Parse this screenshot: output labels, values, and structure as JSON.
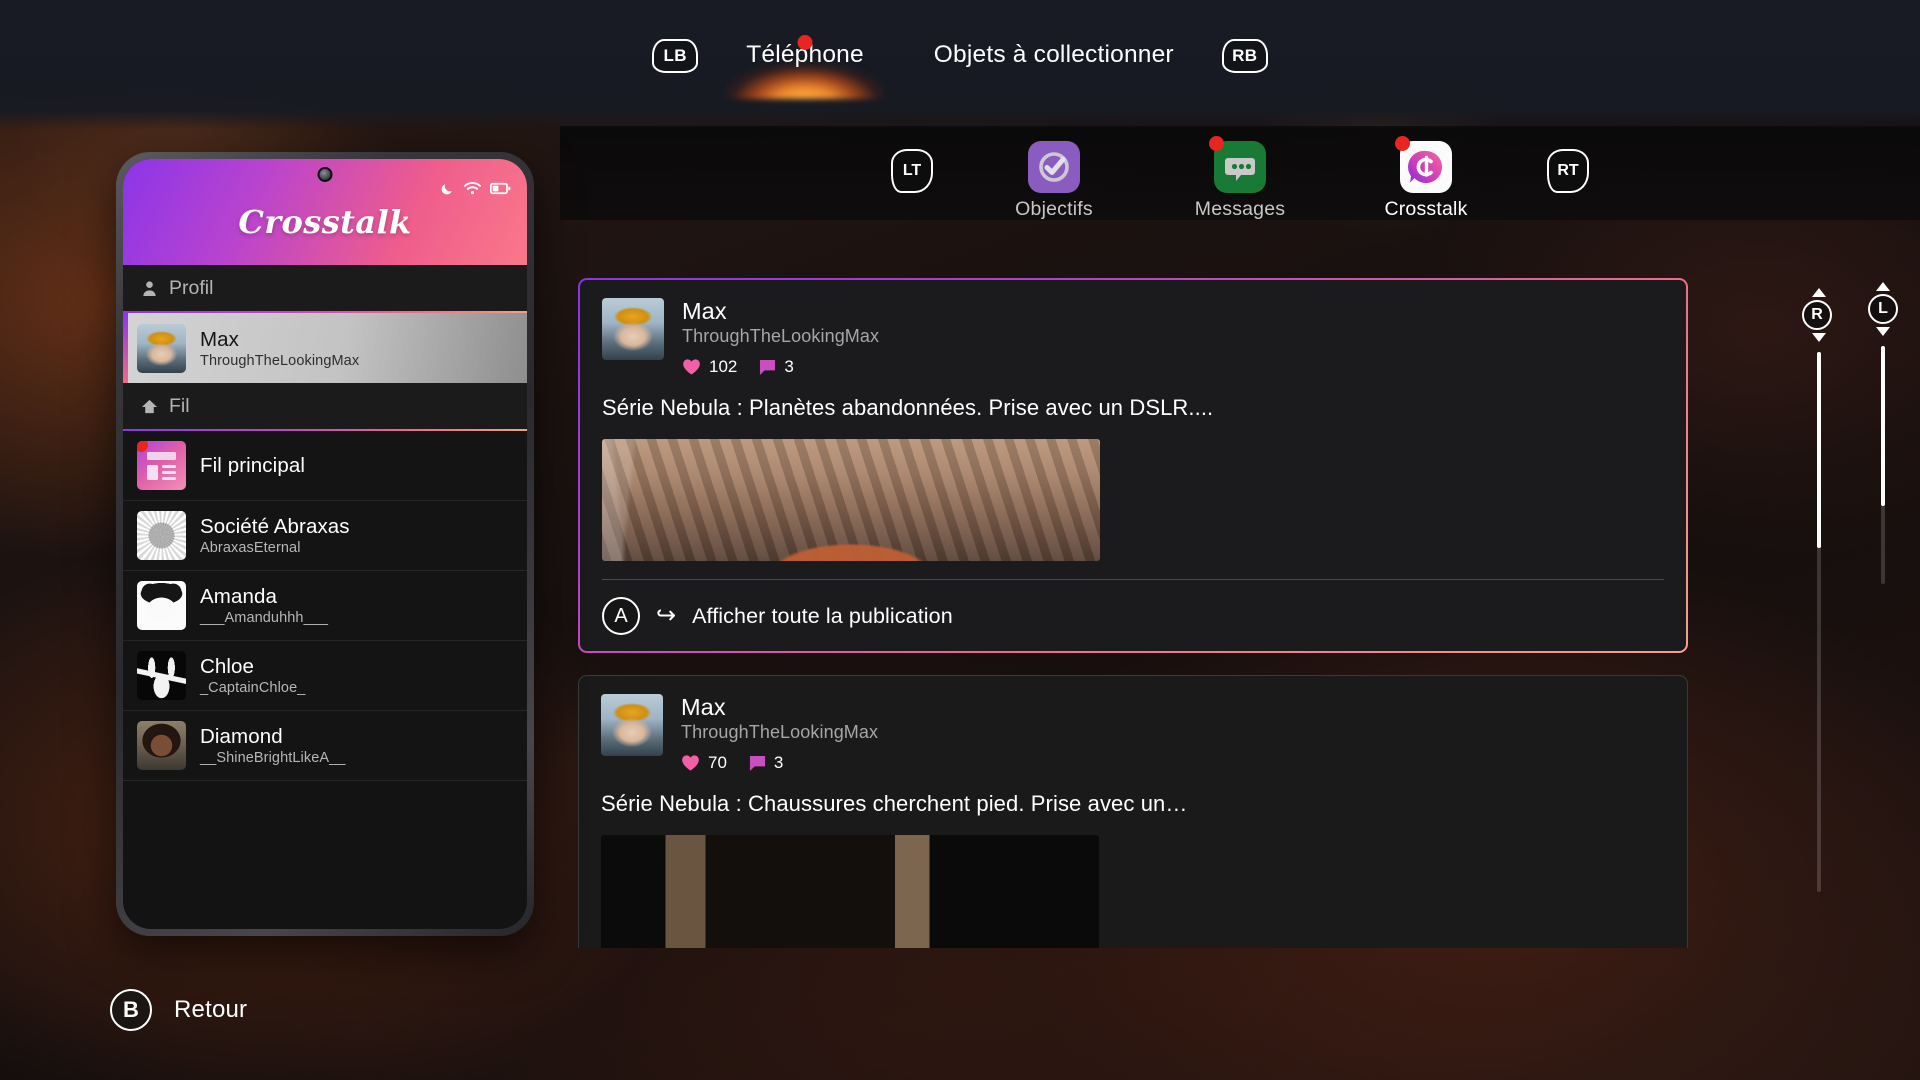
{
  "header": {
    "left_bumper": "LB",
    "right_bumper": "RB",
    "tabs": [
      {
        "label": "Téléphone",
        "active": true,
        "notification": true
      },
      {
        "label": "Objets à collectionner",
        "active": false,
        "notification": false
      }
    ]
  },
  "app_row": {
    "left_trigger": "LT",
    "right_trigger": "RT",
    "apps": [
      {
        "label": "Objectifs",
        "icon": "checkmark-circle-icon",
        "selected": false,
        "notification": false,
        "color": "#8a5cc0"
      },
      {
        "label": "Messages",
        "icon": "speech-bubble-icon",
        "selected": false,
        "notification": true,
        "color": "#197a36"
      },
      {
        "label": "Crosstalk",
        "icon": "crosstalk-c-icon",
        "selected": true,
        "notification": true,
        "color": "#ffffff"
      }
    ]
  },
  "phone": {
    "app_title": "Crosstalk",
    "status_icons": [
      "moon-icon",
      "wifi-icon",
      "battery-icon"
    ],
    "sections": [
      {
        "title": "Profil",
        "icon": "person-icon"
      },
      {
        "title": "Fil",
        "icon": "home-icon"
      }
    ],
    "profile": {
      "name": "Max",
      "handle": "ThroughTheLookingMax",
      "avatar": "max-avatar",
      "selected": true
    },
    "feed_items": [
      {
        "name": "Fil principal",
        "handle": "",
        "avatar": "news-feed-icon",
        "notification": true
      },
      {
        "name": "Société Abraxas",
        "handle": "AbraxasEternal",
        "avatar": "abraxas-avatar",
        "notification": false
      },
      {
        "name": "Amanda",
        "handle": "___Amanduhhh___",
        "avatar": "amanda-avatar",
        "notification": false
      },
      {
        "name": "Chloe",
        "handle": "_CaptainChloe_",
        "avatar": "chloe-avatar",
        "notification": false
      },
      {
        "name": "Diamond",
        "handle": "__ShineBrightLikeA__",
        "avatar": "diamond-avatar",
        "notification": false
      }
    ],
    "scroll_stick": "L"
  },
  "feed": {
    "scroll_stick": "R",
    "posts": [
      {
        "name": "Max",
        "handle": "ThroughTheLookingMax",
        "likes": "102",
        "comments": "3",
        "text": "Série Nebula : Planètes abandonnées. Prise avec un DSLR....",
        "image": "warehouse-photo",
        "selected": true,
        "action_button": "A",
        "action_label": "Afficher toute la publication"
      },
      {
        "name": "Max",
        "handle": "ThroughTheLookingMax",
        "likes": "70",
        "comments": "3",
        "text": "Série Nebula : Chaussures cherchent pied. Prise avec un…",
        "image": "dark-photo",
        "selected": false,
        "action_button": "",
        "action_label": ""
      }
    ]
  },
  "footer": {
    "back_button": "B",
    "back_label": "Retour"
  },
  "colors": {
    "accent_pink": "#ef6b87",
    "accent_purple": "#8c35e8",
    "notification_red": "#e8251f",
    "heart_pink": "#f25ea8"
  }
}
